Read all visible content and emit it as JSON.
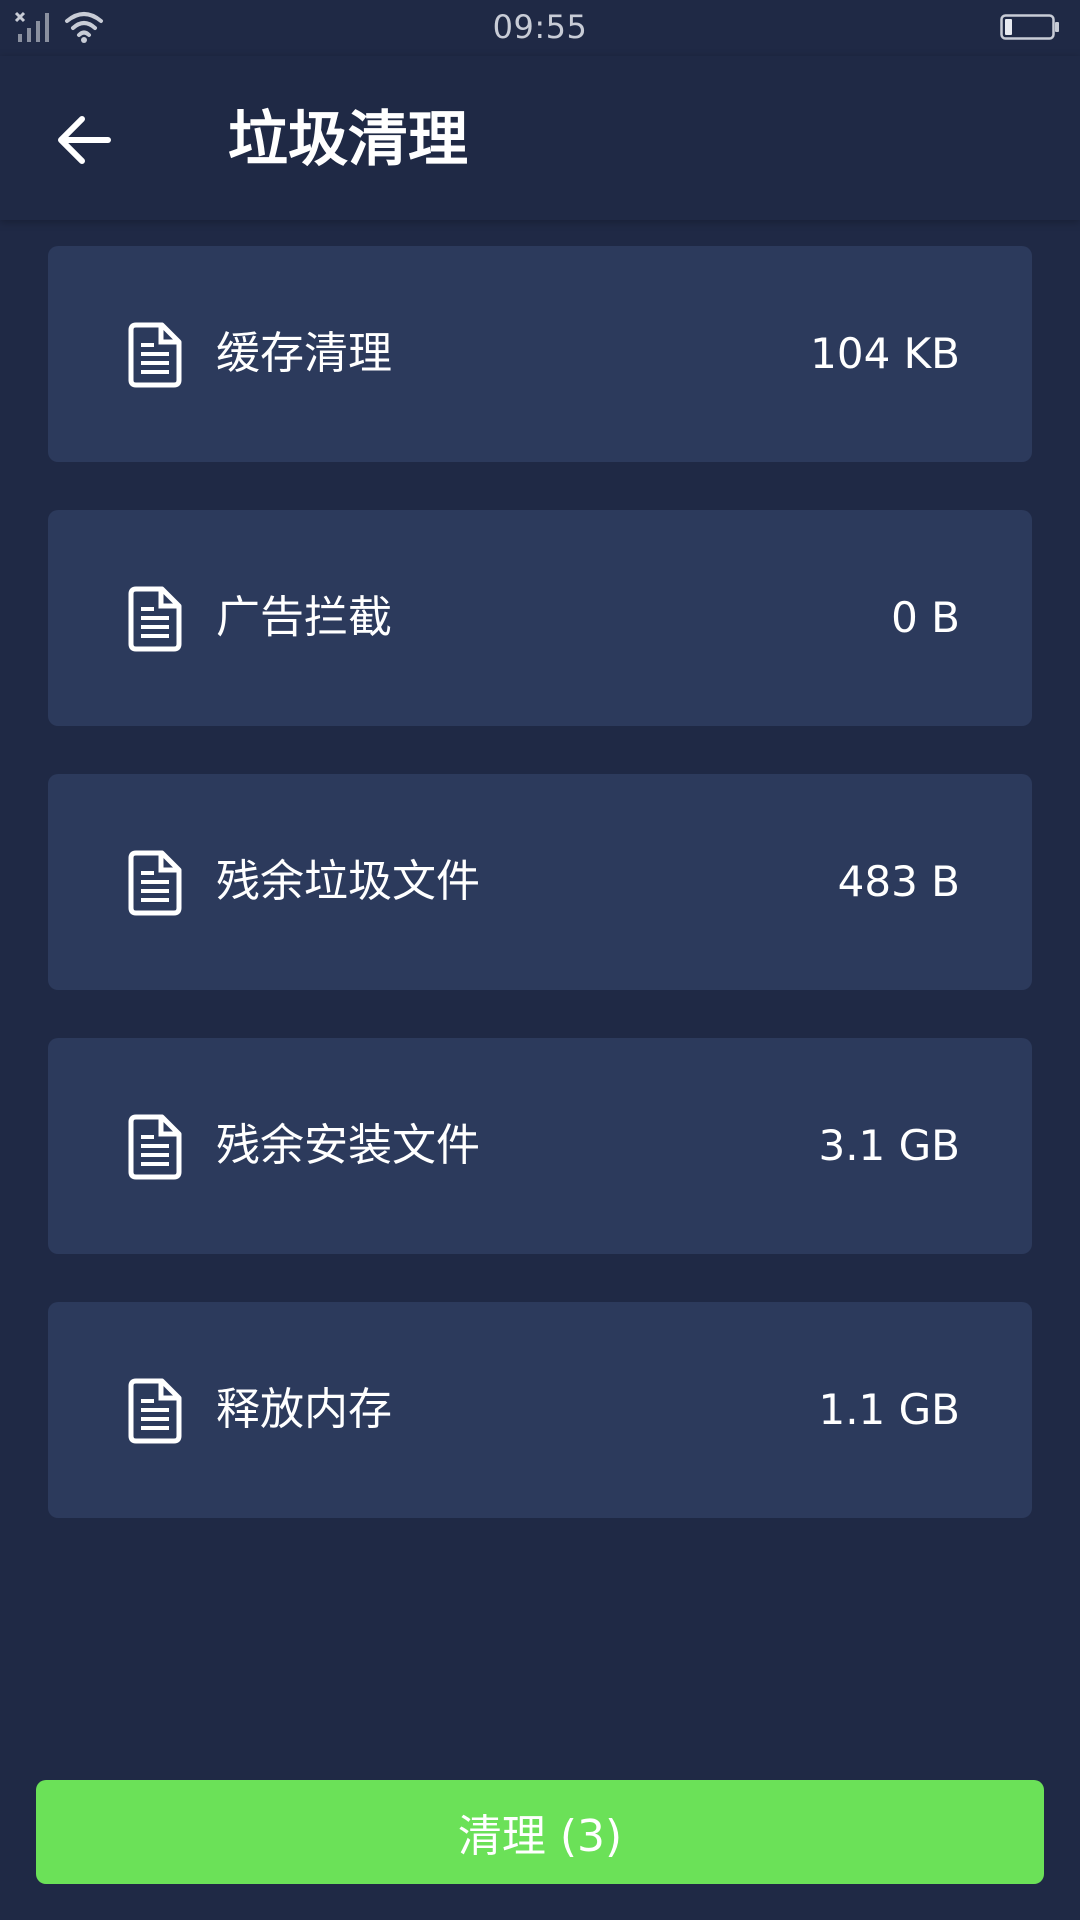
{
  "status_bar": {
    "time": "09:55",
    "battery_level": 0.15,
    "icons": [
      "no-signal-icon",
      "wifi-icon",
      "battery-icon"
    ]
  },
  "header": {
    "title": "垃圾清理",
    "back_icon": "arrow-left-icon"
  },
  "items": [
    {
      "label": "缓存清理",
      "size": "104 KB",
      "icon": "document-icon"
    },
    {
      "label": "广告拦截",
      "size": "0 B",
      "icon": "document-icon"
    },
    {
      "label": "残余垃圾文件",
      "size": "483 B",
      "icon": "document-icon"
    },
    {
      "label": "残余安装文件",
      "size": "3.1 GB",
      "icon": "document-icon"
    },
    {
      "label": "释放内存",
      "size": "1.1 GB",
      "icon": "document-icon"
    }
  ],
  "action": {
    "clean_label": "清理 (3)"
  },
  "colors": {
    "background": "#1f2945",
    "card": "#2c3a5c",
    "accent_green": "#6be158",
    "text": "#ffffff"
  }
}
